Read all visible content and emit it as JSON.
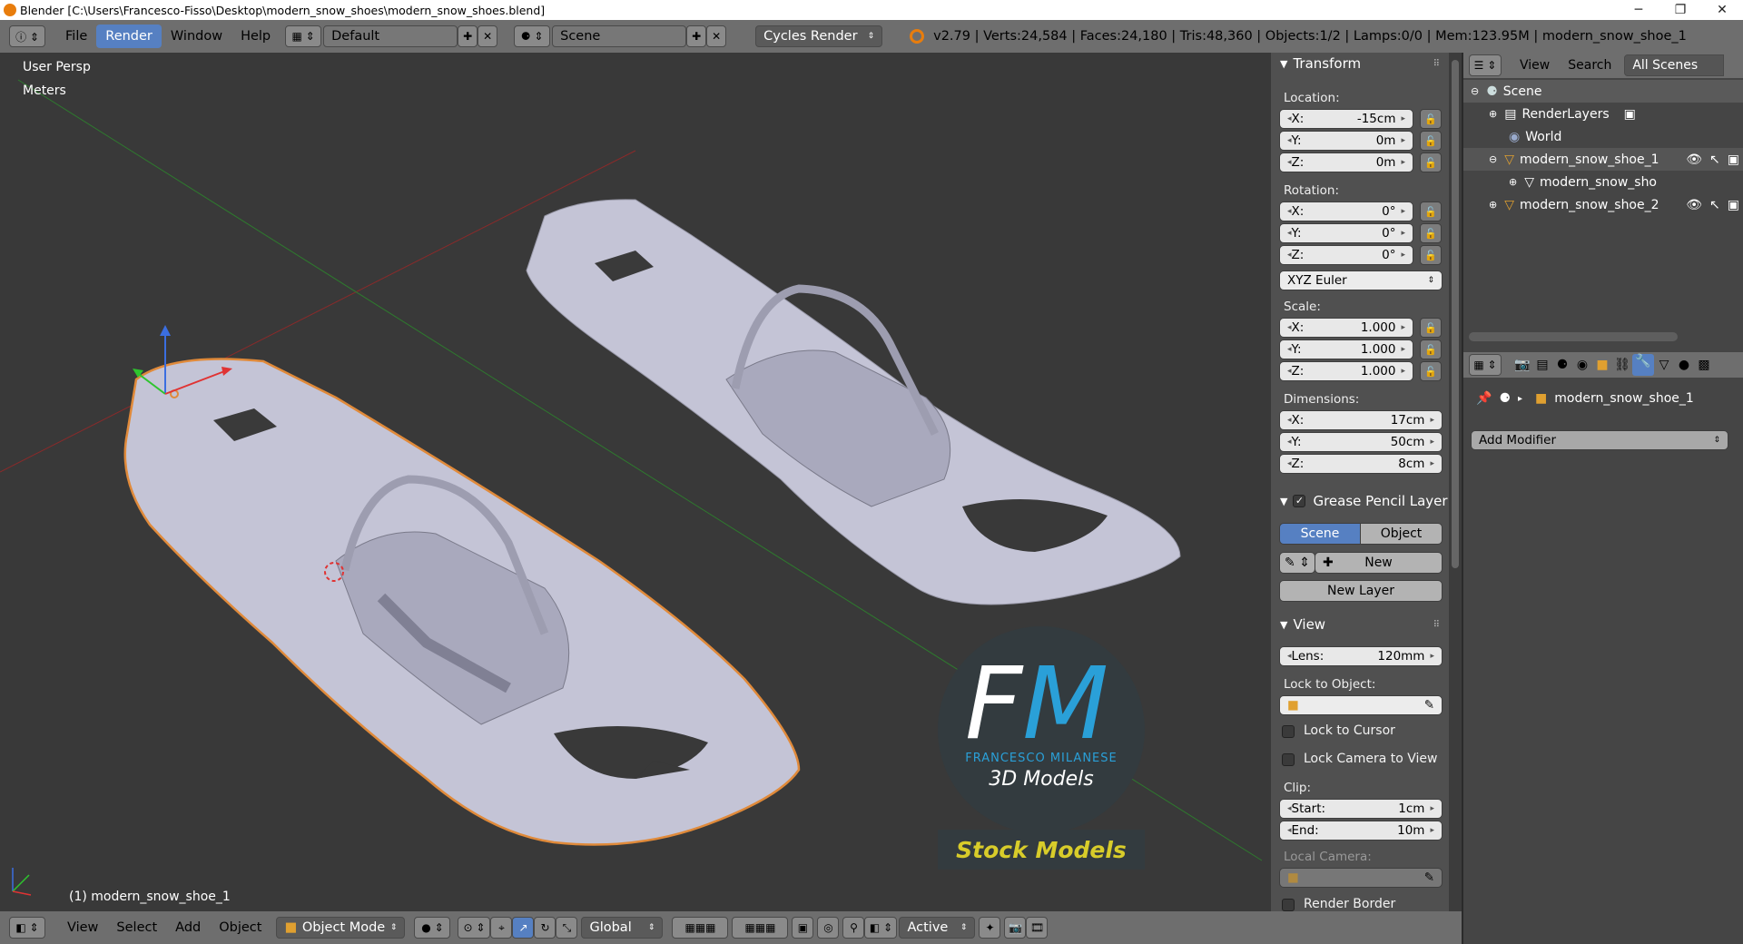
{
  "window": {
    "title": "Blender [C:\\Users\\Francesco-Fisso\\Desktop\\modern_snow_shoes\\modern_snow_shoes.blend]",
    "minimize": "─",
    "maximize": "❐",
    "close": "✕"
  },
  "topbar": {
    "menus": [
      "File",
      "Render",
      "Window",
      "Help"
    ],
    "active_menu": "Render",
    "layout": "Default",
    "scene": "Scene",
    "engine": "Cycles Render",
    "stats": "v2.79 | Verts:24,584 | Faces:24,180 | Tris:48,360 | Objects:1/2 | Lamps:0/0 | Mem:123.95M | modern_snow_shoe_1"
  },
  "viewport": {
    "view_name": "User Persp",
    "units": "Meters",
    "selected_label": "(1) modern_snow_shoe_1",
    "watermark": {
      "initials_f": "F",
      "initials_m": "M",
      "author": "FRANCESCO MILANESE",
      "subtitle": "3D Models",
      "banner": "Stock Models"
    }
  },
  "transform": {
    "header": "Transform",
    "location_label": "Location:",
    "location": [
      {
        "axis": "X:",
        "value": "-15cm"
      },
      {
        "axis": "Y:",
        "value": "0m"
      },
      {
        "axis": "Z:",
        "value": "0m"
      }
    ],
    "rotation_label": "Rotation:",
    "rotation": [
      {
        "axis": "X:",
        "value": "0°"
      },
      {
        "axis": "Y:",
        "value": "0°"
      },
      {
        "axis": "Z:",
        "value": "0°"
      }
    ],
    "rotation_mode": "XYZ Euler",
    "scale_label": "Scale:",
    "scale": [
      {
        "axis": "X:",
        "value": "1.000"
      },
      {
        "axis": "Y:",
        "value": "1.000"
      },
      {
        "axis": "Z:",
        "value": "1.000"
      }
    ],
    "dimensions_label": "Dimensions:",
    "dimensions": [
      {
        "axis": "X:",
        "value": "17cm"
      },
      {
        "axis": "Y:",
        "value": "50cm"
      },
      {
        "axis": "Z:",
        "value": "8cm"
      }
    ]
  },
  "grease_pencil": {
    "header": "Grease Pencil Layer",
    "tab_scene": "Scene",
    "tab_object": "Object",
    "new_label": "New",
    "new_layer_label": "New Layer"
  },
  "view_panel": {
    "header": "View",
    "lens_label": "Lens:",
    "lens_value": "120mm",
    "lock_to_object": "Lock to Object:",
    "lock_to_cursor": "Lock to Cursor",
    "lock_camera": "Lock Camera to View",
    "clip_label": "Clip:",
    "clip_start_label": "Start:",
    "clip_start": "1cm",
    "clip_end_label": "End:",
    "clip_end": "10m",
    "local_camera": "Local Camera:",
    "render_border": "Render Border"
  },
  "outliner": {
    "menus": [
      "View",
      "Search"
    ],
    "filter": "All Scenes",
    "items": [
      {
        "label": "Scene",
        "indent": 0
      },
      {
        "label": "RenderLayers",
        "indent": 1
      },
      {
        "label": "World",
        "indent": 1
      },
      {
        "label": "modern_snow_shoe_1",
        "indent": 1
      },
      {
        "label": "modern_snow_sho",
        "indent": 2
      },
      {
        "label": "modern_snow_shoe_2",
        "indent": 1
      }
    ]
  },
  "properties": {
    "object_name": "modern_snow_shoe_1",
    "add_modifier": "Add Modifier"
  },
  "bottombar": {
    "menus": [
      "View",
      "Select",
      "Add",
      "Object"
    ],
    "mode": "Object Mode",
    "orientation": "Global",
    "pivot": "Active"
  },
  "colors": {
    "accent": "#5680c2",
    "header": "#6e6e6e",
    "viewport": "#393939",
    "panel": "#505050",
    "model": "#c6c6d6",
    "outline": "#e08a3a"
  }
}
